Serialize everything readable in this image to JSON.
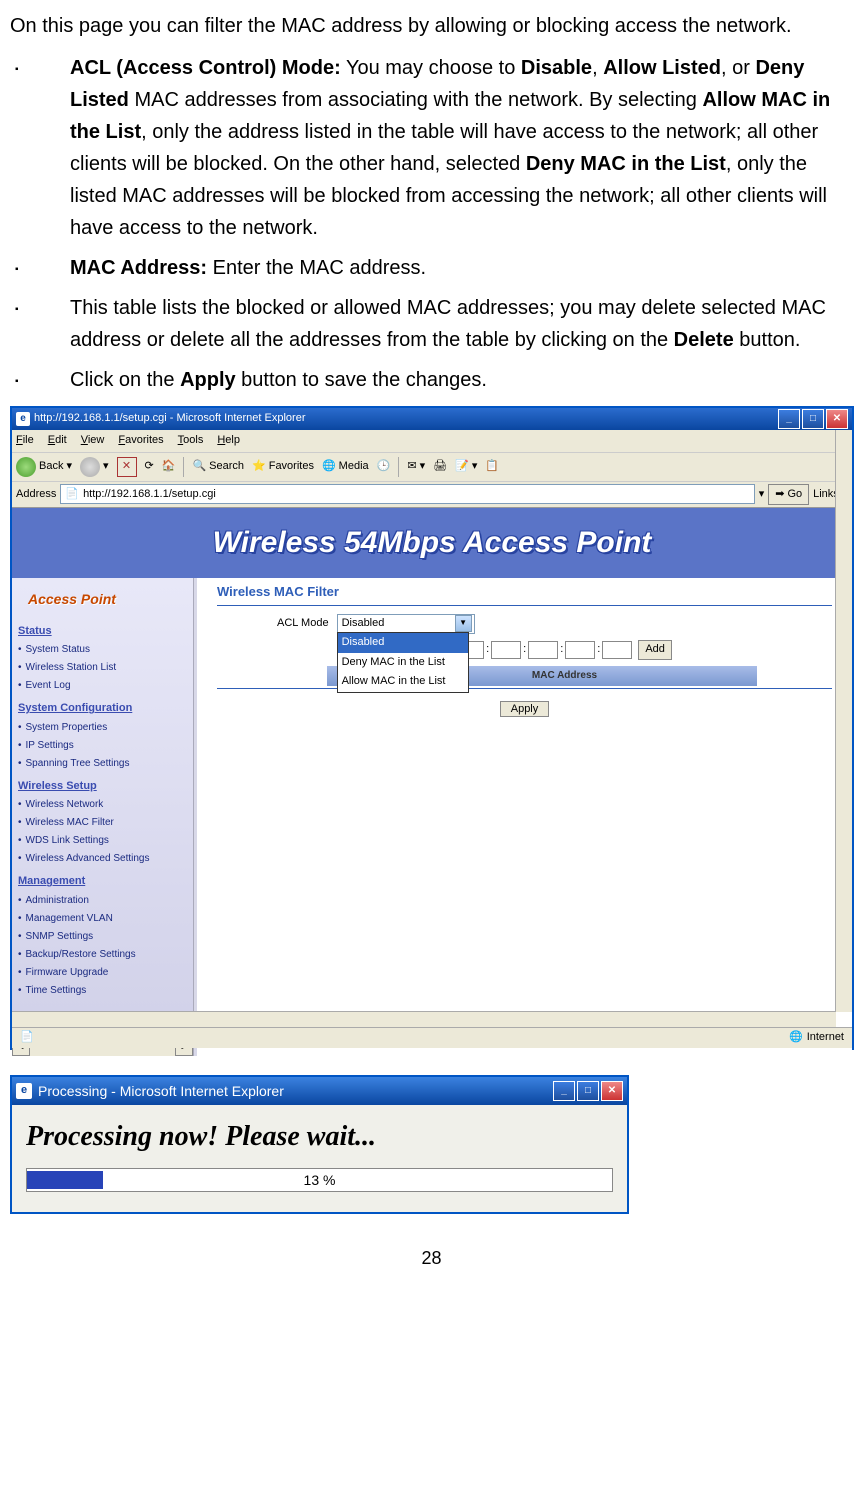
{
  "intro": "On this page you can filter the MAC address by allowing or blocking access the network.",
  "bullets": [
    {
      "parts": [
        {
          "bold": true,
          "text": "ACL (Access Control) Mode:"
        },
        {
          "bold": false,
          "text": " You may choose to "
        },
        {
          "bold": true,
          "text": "Disable"
        },
        {
          "bold": false,
          "text": ", "
        },
        {
          "bold": true,
          "text": "Allow Listed"
        },
        {
          "bold": false,
          "text": ", or "
        },
        {
          "bold": true,
          "text": "Deny Listed"
        },
        {
          "bold": false,
          "text": " MAC addresses from associating with the network. By selecting "
        },
        {
          "bold": true,
          "text": "Allow MAC in the List"
        },
        {
          "bold": false,
          "text": ", only the address listed in the table will have access to the network; all other clients will be blocked. On the other hand, selected "
        },
        {
          "bold": true,
          "text": "Deny MAC in the List"
        },
        {
          "bold": false,
          "text": ", only the listed MAC addresses will be blocked from accessing the network; all other clients will have access to the network."
        }
      ]
    },
    {
      "parts": [
        {
          "bold": true,
          "text": "MAC Address:"
        },
        {
          "bold": false,
          "text": " Enter the MAC address."
        }
      ]
    },
    {
      "parts": [
        {
          "bold": false,
          "text": "This table lists the blocked or allowed MAC addresses; you may delete selected MAC address or delete all the addresses from the table by clicking on the "
        },
        {
          "bold": true,
          "text": "Delete"
        },
        {
          "bold": false,
          "text": " button."
        }
      ]
    },
    {
      "parts": [
        {
          "bold": false,
          "text": "Click on the "
        },
        {
          "bold": true,
          "text": "Apply"
        },
        {
          "bold": false,
          "text": " button to save the changes."
        }
      ]
    }
  ],
  "ie": {
    "title": "http://192.168.1.1/setup.cgi - Microsoft Internet Explorer",
    "menus": [
      "File",
      "Edit",
      "View",
      "Favorites",
      "Tools",
      "Help"
    ],
    "toolbar": {
      "back": "Back",
      "search": "Search",
      "favorites": "Favorites",
      "media": "Media"
    },
    "address_label": "Address",
    "address_value": "http://192.168.1.1/setup.cgi",
    "go": "Go",
    "links": "Links",
    "status_zone": "Internet"
  },
  "ap": {
    "banner": "Wireless 54Mbps Access Point",
    "sidebar_title": "Access Point",
    "groups": [
      {
        "title": "Status",
        "items": [
          "System Status",
          "Wireless Station List",
          "Event Log"
        ]
      },
      {
        "title": "System Configuration",
        "items": [
          "System Properties",
          "IP Settings",
          "Spanning Tree Settings"
        ]
      },
      {
        "title": "Wireless Setup",
        "items": [
          "Wireless Network",
          "Wireless MAC Filter",
          "WDS Link Settings",
          "Wireless Advanced Settings"
        ]
      },
      {
        "title": "Management",
        "items": [
          "Administration",
          "Management VLAN",
          "SNMP Settings",
          "Backup/Restore Settings",
          "Firmware Upgrade",
          "Time Settings"
        ]
      }
    ],
    "section": "Wireless MAC Filter",
    "acl_label": "ACL Mode",
    "acl_selected": "Disabled",
    "acl_options": [
      "Disabled",
      "Deny MAC in the List",
      "Allow MAC in the List"
    ],
    "add_btn": "Add",
    "table_cols": [
      "#",
      "MAC Address"
    ],
    "apply_btn": "Apply"
  },
  "proc": {
    "title": "Processing - Microsoft Internet Explorer",
    "text": "Processing now! Please wait...",
    "pct": "13 %"
  },
  "page_num": "28"
}
